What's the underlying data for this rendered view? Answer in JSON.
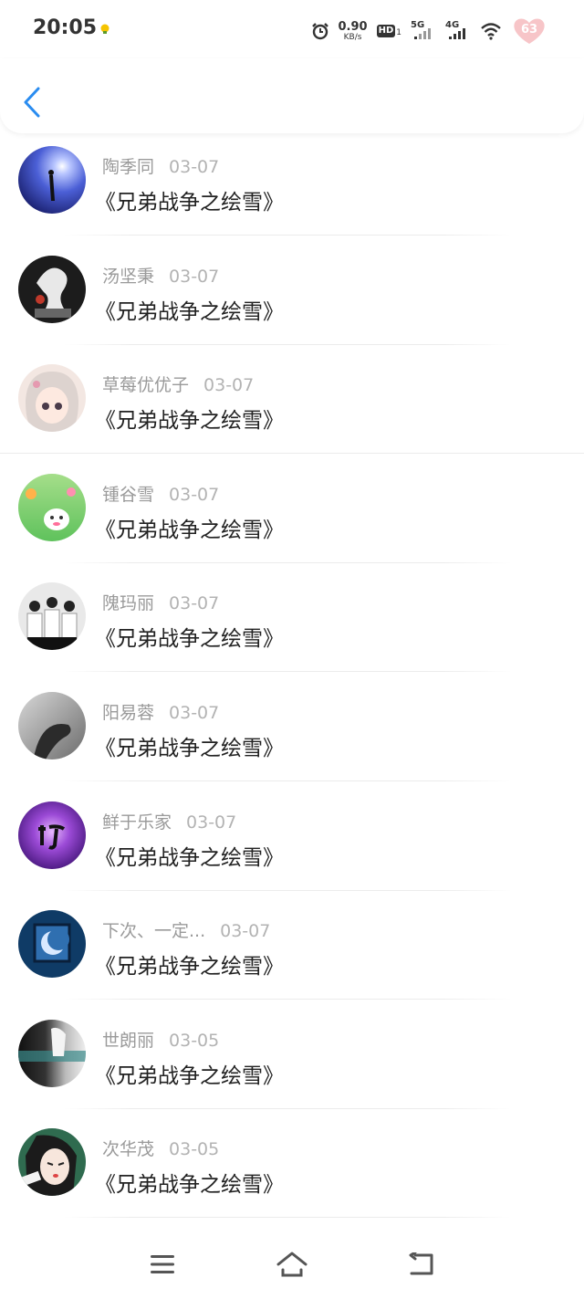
{
  "status_bar": {
    "time": "20:05",
    "speed_value": "0.90",
    "speed_unit": "KB/s",
    "hd_label": "HD",
    "hd_sub": "1",
    "net1_label": "5G",
    "net2_label": "4G",
    "battery": "63",
    "icons": [
      "alarm-icon",
      "hd-icon",
      "signal-5g-icon",
      "signal-4g-icon",
      "wifi-icon",
      "battery-heart-icon"
    ]
  },
  "header": {
    "back_icon": "chevron-left-icon",
    "accent_color": "#2a8cf0"
  },
  "list": [
    {
      "name": "陶季同",
      "date": "03-07",
      "title": "《兄弟战争之绘雪》"
    },
    {
      "name": "汤坚秉",
      "date": "03-07",
      "title": "《兄弟战争之绘雪》"
    },
    {
      "name": "草莓优优子",
      "date": "03-07",
      "title": "《兄弟战争之绘雪》"
    },
    {
      "name": "锺谷雪",
      "date": "03-07",
      "title": "《兄弟战争之绘雪》"
    },
    {
      "name": "隗玛丽",
      "date": "03-07",
      "title": "《兄弟战争之绘雪》"
    },
    {
      "name": "阳易蓉",
      "date": "03-07",
      "title": "《兄弟战争之绘雪》"
    },
    {
      "name": "鲜于乐家",
      "date": "03-07",
      "title": "《兄弟战争之绘雪》"
    },
    {
      "name": "下次、一定...",
      "date": "03-07",
      "title": "《兄弟战争之绘雪》"
    },
    {
      "name": "世朗丽",
      "date": "03-05",
      "title": "《兄弟战争之绘雪》"
    },
    {
      "name": "次华茂",
      "date": "03-05",
      "title": "《兄弟战争之绘雪》"
    }
  ],
  "nav_bar": {
    "icons": [
      "menu-icon",
      "home-icon",
      "back-icon"
    ]
  }
}
